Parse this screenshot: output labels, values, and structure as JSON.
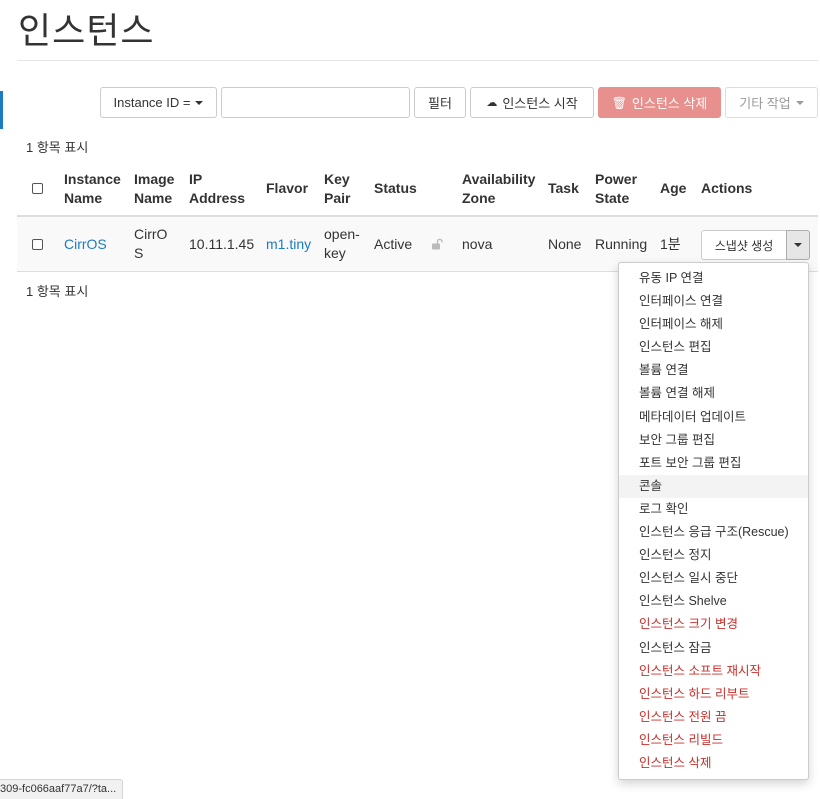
{
  "page": {
    "title": "인스턴스"
  },
  "toolbar": {
    "filter_field": "Instance ID =",
    "filter_value": "",
    "filter_label": "필터",
    "launch_label": "인스턴스 시작",
    "delete_label": "인스턴스 삭제",
    "more_label": "기타 작업"
  },
  "summary": {
    "top": "1 항목 표시",
    "bottom": "1 항목 표시"
  },
  "table": {
    "headers": {
      "name": "Instance Name",
      "image": "Image Name",
      "ip": "IP Address",
      "flavor": "Flavor",
      "keypair": "Key Pair",
      "status": "Status",
      "zone": "Availability Zone",
      "task": "Task",
      "power": "Power State",
      "age": "Age",
      "actions": "Actions"
    },
    "rows": [
      {
        "name": "CirrOS",
        "image": "CirrOS",
        "ip": "10.11.1.45",
        "flavor": "m1.tiny",
        "keypair": "open-key",
        "status": "Active",
        "zone": "nova",
        "task": "None",
        "power": "Running",
        "age": "1분",
        "action": "스냅샷 생성"
      }
    ]
  },
  "menu": {
    "items": [
      {
        "label": "유동 IP 연결",
        "danger": false
      },
      {
        "label": "인터페이스 연결",
        "danger": false
      },
      {
        "label": "인터페이스 해제",
        "danger": false
      },
      {
        "label": "인스턴스 편집",
        "danger": false
      },
      {
        "label": "볼륨 연결",
        "danger": false
      },
      {
        "label": "볼륨 연결 해제",
        "danger": false
      },
      {
        "label": "메타데이터 업데이트",
        "danger": false
      },
      {
        "label": "보안 그룹 편집",
        "danger": false
      },
      {
        "label": "포트 보안 그룹 편집",
        "danger": false
      },
      {
        "label": "콘솔",
        "danger": false
      },
      {
        "label": "로그 확인",
        "danger": false
      },
      {
        "label": "인스턴스 응급 구조(Rescue)",
        "danger": false
      },
      {
        "label": "인스턴스 정지",
        "danger": false
      },
      {
        "label": "인스턴스 일시 중단",
        "danger": false
      },
      {
        "label": "인스턴스 Shelve",
        "danger": false
      },
      {
        "label": "인스턴스 크기 변경",
        "danger": true
      },
      {
        "label": "인스턴스 잠금",
        "danger": false
      },
      {
        "label": "인스턴스 소프트 재시작",
        "danger": true
      },
      {
        "label": "인스턴스 하드 리부트",
        "danger": true
      },
      {
        "label": "인스턴스 전원 끔",
        "danger": true
      },
      {
        "label": "인스턴스 리빌드",
        "danger": true
      },
      {
        "label": "인스턴스 삭제",
        "danger": true
      }
    ]
  },
  "statusbar": {
    "url": "309-fc066aaf77a7/?ta..."
  },
  "colors": {
    "link": "#1f7bc1",
    "danger": "#c9302c",
    "delete_button": "#e7908e"
  }
}
